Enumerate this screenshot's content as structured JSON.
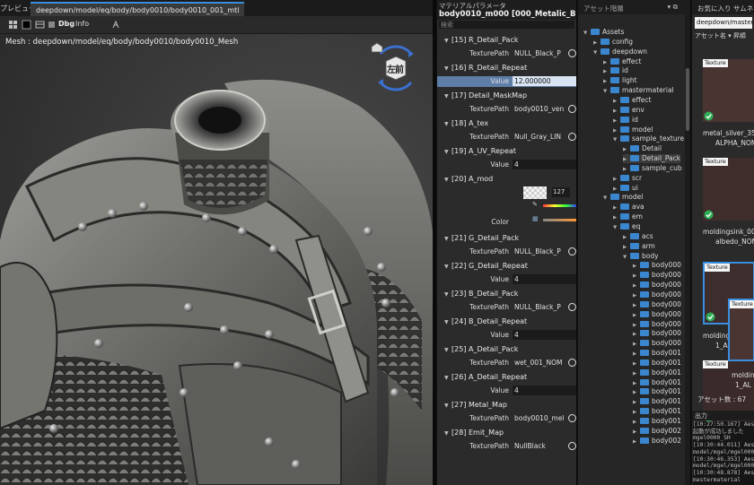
{
  "viewport": {
    "tab_label": "プレビュー",
    "tab_title": "deepdown/model/eq/body/body0010/body0010_001_mtl",
    "toolbar": {
      "dbg_label": "Dbg",
      "info_label": "Info"
    },
    "mesh_label": "Mesh : deepdown/model/eq/body/body0010/body0010_Mesh",
    "nav_cube_face": "左前"
  },
  "material_panel": {
    "tab_label": "マテリアルパラメータ",
    "title": "body0010_m000 [000_Metalic_Blend_D",
    "search_placeholder": "検索",
    "params": [
      {
        "name": "[15] R_Detail_Pack",
        "rows": [
          {
            "label": "TexturePath",
            "value": "NULL_Black_P"
          }
        ]
      },
      {
        "name": "[16] R_Detail_Repeat",
        "rows": [
          {
            "label": "Value",
            "value": "12.000000",
            "selected": true
          }
        ]
      },
      {
        "name": "[17] Detail_MaskMap",
        "rows": [
          {
            "label": "TexturePath",
            "value": "body0010_ven"
          }
        ]
      },
      {
        "name": "[18] A_tex",
        "rows": [
          {
            "label": "TexturePath",
            "value": "Null_Gray_LIN"
          }
        ]
      },
      {
        "name": "[19] A_UV_Repeat",
        "rows": [
          {
            "label": "Value",
            "value": "4"
          }
        ]
      },
      {
        "name": "[20] A_mod",
        "rows": [
          {
            "label": "Color",
            "value": "127"
          }
        ]
      },
      {
        "name": "[21] G_Detail_Pack",
        "rows": [
          {
            "label": "TexturePath",
            "value": "NULL_Black_P"
          }
        ]
      },
      {
        "name": "[22] G_Detail_Repeat",
        "rows": [
          {
            "label": "Value",
            "value": "4"
          }
        ]
      },
      {
        "name": "[23] B_Detail_Pack",
        "rows": [
          {
            "label": "TexturePath",
            "value": "NULL_Black_P"
          }
        ]
      },
      {
        "name": "[24] B_Detail_Repeat",
        "rows": [
          {
            "label": "Value",
            "value": "4"
          }
        ]
      },
      {
        "name": "[25] A_Detail_Pack",
        "rows": [
          {
            "label": "TexturePath",
            "value": "wet_001_NOM"
          }
        ]
      },
      {
        "name": "[26] A_Detail_Repeat",
        "rows": [
          {
            "label": "Value",
            "value": "4"
          }
        ]
      },
      {
        "name": "[27] Metal_Map",
        "rows": [
          {
            "label": "TexturePath",
            "value": "body0010_mel"
          }
        ]
      },
      {
        "name": "[28] Emit_Map",
        "rows": [
          {
            "label": "TexturePath",
            "value": "NullBlack"
          }
        ]
      }
    ]
  },
  "asset_tree": {
    "header": "アセット階層",
    "nodes": [
      {
        "label": "Assets",
        "depth": 0,
        "open": true
      },
      {
        "label": "config",
        "depth": 1
      },
      {
        "label": "deepdown",
        "depth": 1,
        "open": true
      },
      {
        "label": "effect",
        "depth": 2
      },
      {
        "label": "id",
        "depth": 2
      },
      {
        "label": "light",
        "depth": 2
      },
      {
        "label": "mastermaterial",
        "depth": 2,
        "open": true
      },
      {
        "label": "effect",
        "depth": 3
      },
      {
        "label": "env",
        "depth": 3
      },
      {
        "label": "id",
        "depth": 3
      },
      {
        "label": "model",
        "depth": 3
      },
      {
        "label": "sample_texture",
        "depth": 3,
        "open": true
      },
      {
        "label": "Detail",
        "depth": 4
      },
      {
        "label": "Detail_Pack",
        "depth": 4,
        "selected": true
      },
      {
        "label": "sample_cub",
        "depth": 4
      },
      {
        "label": "scr",
        "depth": 3
      },
      {
        "label": "ui",
        "depth": 3
      },
      {
        "label": "model",
        "depth": 2,
        "open": true
      },
      {
        "label": "ava",
        "depth": 3
      },
      {
        "label": "em",
        "depth": 3
      },
      {
        "label": "eq",
        "depth": 3,
        "open": true
      },
      {
        "label": "acs",
        "depth": 4
      },
      {
        "label": "arm",
        "depth": 4
      },
      {
        "label": "body",
        "depth": 4,
        "open": true
      },
      {
        "label": "body000",
        "depth": 5
      },
      {
        "label": "body000",
        "depth": 5
      },
      {
        "label": "body000",
        "depth": 5
      },
      {
        "label": "body000",
        "depth": 5
      },
      {
        "label": "body000",
        "depth": 5
      },
      {
        "label": "body000",
        "depth": 5
      },
      {
        "label": "body000",
        "depth": 5
      },
      {
        "label": "body000",
        "depth": 5
      },
      {
        "label": "body000",
        "depth": 5
      },
      {
        "label": "body001",
        "depth": 5
      },
      {
        "label": "body001",
        "depth": 5
      },
      {
        "label": "body001",
        "depth": 5
      },
      {
        "label": "body001",
        "depth": 5
      },
      {
        "label": "body001",
        "depth": 5
      },
      {
        "label": "body001",
        "depth": 5
      },
      {
        "label": "body001",
        "depth": 5
      },
      {
        "label": "body001",
        "depth": 5
      },
      {
        "label": "body002",
        "depth": 5
      },
      {
        "label": "body002",
        "depth": 5
      }
    ]
  },
  "favorites": {
    "tabs": "お気に入り  サムネイル",
    "path": "deepdown/mastermat",
    "sort_label": "アセット名  ▾  昇順",
    "assets": [
      {
        "badge": "Texture",
        "name1": "metal_silver_35",
        "name2": "ALPHA_NOM",
        "color": "#4a3431"
      },
      {
        "badge": "Texture",
        "name1": "moldingsink_00",
        "name2": "albedo_NOM",
        "color": "#3f2d2b"
      },
      {
        "badge": "Texture",
        "name1": "moldingsink_su",
        "name2": "1_ALPHA_NOM",
        "color": "#3d2d2c"
      },
      {
        "badge": "Texture",
        "name1": "moldin",
        "name2": "1_AL",
        "color": "#3a2b2a"
      }
    ],
    "asset_count": "アセット数 : 67",
    "output_tab": "出力",
    "log_lines": [
      "[10:27:50.167] Aes",
      "起動が成功しました",
      "mgel0000_SH",
      "[10:30:44.011] Aes",
      "model/mgel/mgel000",
      "[10:30:46.353] Aes",
      "model/mgel/mgel000",
      "[10:30:48.878] Aes",
      "mastermaterial"
    ]
  }
}
